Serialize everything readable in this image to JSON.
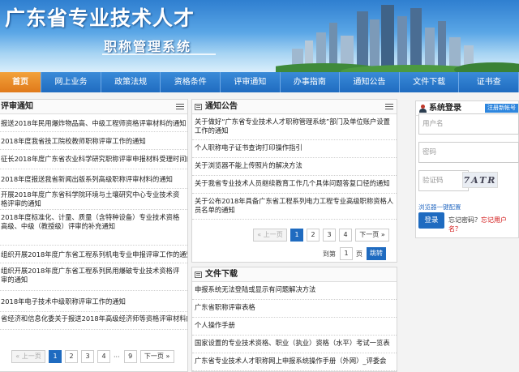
{
  "header": {
    "site_title": "广东省专业技术人才",
    "sub_title": "职称管理系统"
  },
  "nav": [
    {
      "label": "首页",
      "active": true
    },
    {
      "label": "网上业务"
    },
    {
      "label": "政策法规"
    },
    {
      "label": "资格条件"
    },
    {
      "label": "评审通知"
    },
    {
      "label": "办事指南"
    },
    {
      "label": "通知公告"
    },
    {
      "label": "文件下载"
    },
    {
      "label": "证书查"
    }
  ],
  "review_notice": {
    "title": "评审通知",
    "items": [
      "报送2018年民用爆炸物品高、中级工程师资格评审材料的通知",
      "2018年度我省技工院校教师职称评审工作的通知",
      "征长2018年度广东省农业科学研究职称评审申报材料受理时间的",
      "2018年度报送我省新闻出版系列高级职称评审材料的通知",
      "开展2018年度广东省科学院环境与土壤研究中心专业技术资格评审的通知",
      "2018年度标准化、计量、质量（含特种设备）专业技术资格高级、中级（教授级）评审的补充通知",
      "组织开展2018年度广东省工程系列机电专业申报评审工作的通知",
      "组织开展2018年度广东省工程系列民用爆破专业技术资格评审的通知",
      "2018年电子技术中级职称评审工作的通知",
      "省经济和信息化委关于报送2018年高级经济师等资格评审材料的"
    ],
    "pager": {
      "prev": "« 上一页",
      "pages": [
        "1",
        "2",
        "3",
        "4"
      ],
      "ellipsis": "···",
      "last": "9",
      "next": "下一页 »",
      "current": "1"
    }
  },
  "announcements": {
    "title": "通知公告",
    "items": [
      "关于做好“广东省专业技术人才职称管理系统”部门及单位账户设置工作的通知",
      "个人职称电子证书查询打印操作指引",
      "关于浏览器不能上传照片的解决方法",
      "关于我省专业技术人员继续教育工作几个具体问题答复口径的通知",
      "关于公布2018年具备广东省工程系列电力工程专业高级职称资格人员名单的通知"
    ],
    "pager": {
      "prev": "« 上一页",
      "pages": [
        "1",
        "2",
        "3",
        "4"
      ],
      "next": "下一页 »",
      "current": "1",
      "goto_label": "到第",
      "goto_value": "1",
      "page_unit": "页",
      "jump": "跳转"
    }
  },
  "downloads": {
    "title": "文件下载",
    "items": [
      "申报系统无法登陆或显示有问题解决方法",
      "广东省职称评审表格",
      "个人操作手册",
      "国家设置的专业技术资格、职业（执业）资格（水平）考试一览表",
      "广东省专业技术人才职称网上申报系统操作手册（外网）_评委会"
    ]
  },
  "login": {
    "title": "系统登录",
    "register": "注册新帐号",
    "user_placeholder": "用户名",
    "password_placeholder": "密码",
    "captcha_placeholder": "验证码",
    "captcha_text": "7ATR",
    "remember": "浏览器一键配置",
    "submit": "登录",
    "forgot_prefix": "忘记密码？",
    "forgot_user": "忘记用户名？"
  },
  "colors": {
    "nav_blue": "#1f6bc0",
    "nav_active": "#e0791a",
    "accent_red": "#d01010"
  }
}
